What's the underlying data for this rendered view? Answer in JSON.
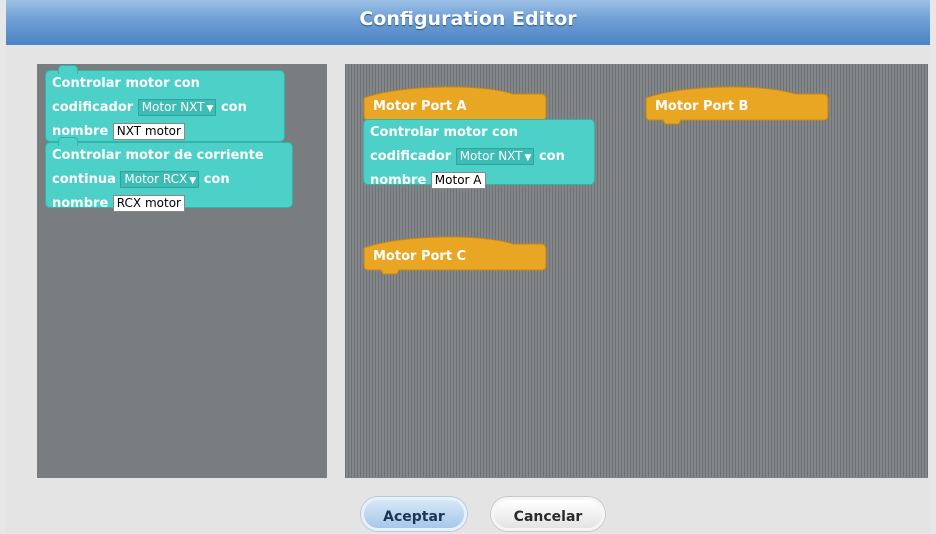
{
  "window": {
    "title": "Configuration Editor"
  },
  "palette": {
    "blocks": [
      {
        "line1": "Controlar motor con",
        "line2_pre": "codificador",
        "dropdown": "Motor NXT",
        "line2_post": "con",
        "line3_pre": "nombre",
        "input": "NXT motor"
      },
      {
        "line1": "Controlar motor de corriente",
        "line2_pre": "continua",
        "dropdown": "Motor RCX",
        "line2_post": "con",
        "line3_pre": "nombre",
        "input": "RCX motor"
      }
    ]
  },
  "script": {
    "hats": [
      {
        "label": "Motor Port A"
      },
      {
        "label": "Motor Port B"
      },
      {
        "label": "Motor Port C"
      }
    ],
    "attached_block": {
      "line1": "Controlar motor con",
      "line2_pre": "codificador",
      "dropdown": "Motor NXT",
      "line2_post": "con",
      "line3_pre": "nombre",
      "input": "Motor A"
    }
  },
  "buttons": {
    "ok": "Aceptar",
    "cancel": "Cancelar"
  },
  "colors": {
    "block": "#4dd0c8",
    "hat": "#e9a623",
    "title_bar": "#5f93cd"
  }
}
